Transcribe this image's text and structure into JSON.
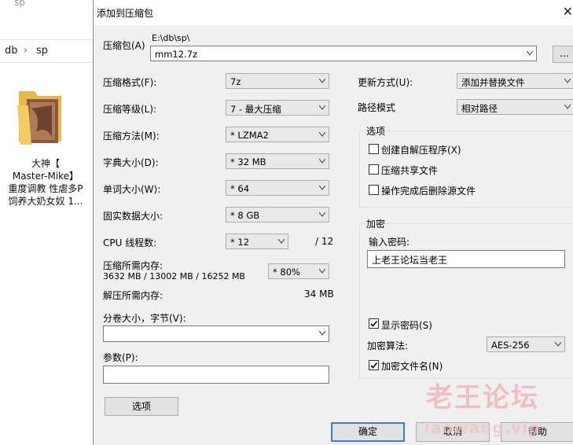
{
  "explorer": {
    "top_text": "sp",
    "path": [
      "db",
      "sp"
    ],
    "file_name_lines": [
      "大神【",
      "Master-Mike】",
      "重度调教 性虐多P",
      "饲养大奶女奴 1..."
    ]
  },
  "dialog": {
    "title": "添加到压缩包",
    "archive_label": "压缩包(A)",
    "archive_dir": "E:\\db\\sp\\",
    "archive_name": "mm12.7z",
    "browse_label": "...",
    "format_label": "压缩格式(F):",
    "format_value": "7z",
    "level_label": "压缩等级(L):",
    "level_value": "7 - 最大压缩",
    "method_label": "压缩方法(M):",
    "method_value": "* LZMA2",
    "dict_label": "字典大小(D):",
    "dict_value": "* 32 MB",
    "word_label": "单词大小(W):",
    "word_value": "* 64",
    "solid_label": "固实数据大小:",
    "solid_value": "* 8 GB",
    "threads_label": "CPU 线程数:",
    "threads_value": "* 12",
    "threads_total": "/ 12",
    "mem_comp_label": "压缩所需内存:",
    "mem_comp_detail": "3632 MB / 13002 MB / 16252 MB",
    "mem_percent": "* 80%",
    "mem_decomp_label": "解压所需内存:",
    "mem_decomp_value": "34 MB",
    "split_label": "分卷大小，字节(V):",
    "split_value": "",
    "params_label": "参数(P):",
    "params_value": "",
    "options_button": "选项",
    "update_label": "更新方式(U):",
    "update_value": "添加并替换文件",
    "path_label": "路径模式",
    "path_value": "相对路径",
    "options_group": {
      "title": "选项",
      "items": [
        {
          "label": "创建自解压程序(X)",
          "checked": false
        },
        {
          "label": "压缩共享文件",
          "checked": false
        },
        {
          "label": "操作完成后删除源文件",
          "checked": false
        }
      ]
    },
    "encryption": {
      "title": "加密",
      "password_label": "输入密码:",
      "password_value": "上老王论坛当老王",
      "show_password": "显示密码(S)",
      "algo_label": "加密算法:",
      "algo_value": "AES-256",
      "encrypt_names": "加密文件名(N)"
    },
    "ok": "确定",
    "cancel": "取消",
    "help": "帮助"
  },
  "watermark": {
    "text": "老王论坛",
    "sub": "laowang.vip"
  }
}
